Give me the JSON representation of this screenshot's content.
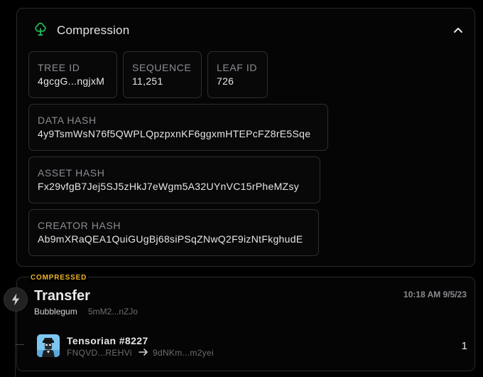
{
  "compression": {
    "title": "Compression",
    "icon": "tree-icon",
    "collapse_icon": "chevron-up-icon",
    "accent": "#22c55e",
    "fields": {
      "tree_id": {
        "label": "TREE ID",
        "value": "4gcgG...ngjxM"
      },
      "sequence": {
        "label": "SEQUENCE",
        "value": "11,251"
      },
      "leaf_id": {
        "label": "LEAF ID",
        "value": "726"
      },
      "data_hash": {
        "label": "DATA HASH",
        "value": "4y9TsmWsN76f5QWPLQpzpxnKF6ggxmHTEPcFZ8rE5Sqe"
      },
      "asset_hash": {
        "label": "ASSET HASH",
        "value": "Fx29vfgB7Jej5SJ5zHkJ7eWgm5A32UYnVC15rPheMZsy"
      },
      "creator_hash": {
        "label": "CREATOR HASH",
        "value": "Ab9mXRaQEA1QuiGUgBj68siPSqZNwQ2F9izNtFkghudE"
      }
    }
  },
  "transaction": {
    "badge": "COMPRESSED",
    "badge_color": "#f0b429",
    "icon": "lightning-bolt-icon",
    "title": "Transfer",
    "program": "Bubblegum",
    "program_address": "5mM2...nZJo",
    "time": "10:18 AM 9/5/23",
    "nft": {
      "name": "Tensorian #8227",
      "from": "FNQVD...REHVi",
      "to": "9dNKm...m2yei",
      "quantity": "1",
      "image_icon": "tensorian-avatar-icon",
      "arrow_icon": "arrow-right-icon"
    }
  }
}
